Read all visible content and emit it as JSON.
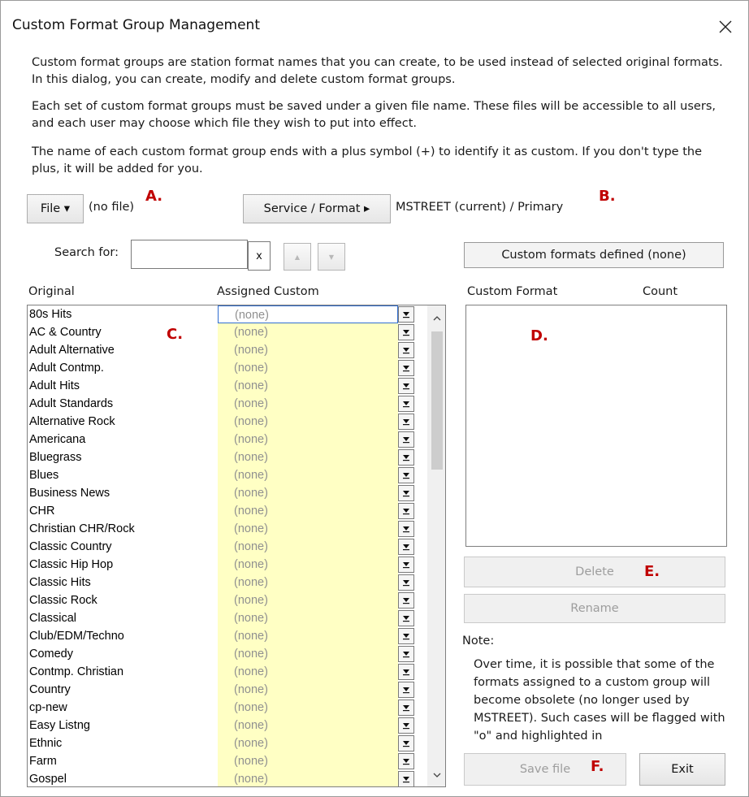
{
  "window": {
    "title": "Custom Format Group Management"
  },
  "intro": {
    "p1": "Custom format groups are station format names that you can create, to be used instead of selected original formats. In this dialog, you can create, modify and delete custom format groups.",
    "p2": "Each set of custom format groups must be saved under a given file name. These files will be accessible to all users, and each user may choose which file they wish to put into effect.",
    "p3": "The name of each custom format group ends with a plus symbol (+) to identify it as custom. If you don't type the plus, it will be added for you."
  },
  "toolbar": {
    "file_button": "File ▾",
    "file_status": "(no file)",
    "service_button": "Service / Format ▸",
    "service_status": "MSTREET (current) / Primary"
  },
  "search": {
    "label": "Search for:",
    "value": "",
    "clear_label": "x",
    "up_label": "▲",
    "down_label": "▼"
  },
  "status_box": "Custom formats defined (none)",
  "headers": {
    "original": "Original",
    "assigned": "Assigned Custom",
    "custom_format": "Custom Format",
    "count": "Count"
  },
  "rows": [
    {
      "original": "80s Hits",
      "assigned": "(none)"
    },
    {
      "original": "AC & Country",
      "assigned": "(none)"
    },
    {
      "original": "Adult Alternative",
      "assigned": "(none)"
    },
    {
      "original": "Adult Contmp.",
      "assigned": "(none)"
    },
    {
      "original": "Adult Hits",
      "assigned": "(none)"
    },
    {
      "original": "Adult Standards",
      "assigned": "(none)"
    },
    {
      "original": "Alternative Rock",
      "assigned": "(none)"
    },
    {
      "original": "Americana",
      "assigned": "(none)"
    },
    {
      "original": "Bluegrass",
      "assigned": "(none)"
    },
    {
      "original": "Blues",
      "assigned": "(none)"
    },
    {
      "original": "Business News",
      "assigned": "(none)"
    },
    {
      "original": "CHR",
      "assigned": "(none)"
    },
    {
      "original": "Christian CHR/Rock",
      "assigned": "(none)"
    },
    {
      "original": "Classic Country",
      "assigned": "(none)"
    },
    {
      "original": "Classic Hip Hop",
      "assigned": "(none)"
    },
    {
      "original": "Classic Hits",
      "assigned": "(none)"
    },
    {
      "original": "Classic Rock",
      "assigned": "(none)"
    },
    {
      "original": "Classical",
      "assigned": "(none)"
    },
    {
      "original": "Club/EDM/Techno",
      "assigned": "(none)"
    },
    {
      "original": "Comedy",
      "assigned": "(none)"
    },
    {
      "original": "Contmp. Christian",
      "assigned": "(none)"
    },
    {
      "original": "Country",
      "assigned": "(none)"
    },
    {
      "original": "cp-new",
      "assigned": "(none)"
    },
    {
      "original": "Easy Listng",
      "assigned": "(none)"
    },
    {
      "original": "Ethnic",
      "assigned": "(none)"
    },
    {
      "original": "Farm",
      "assigned": "(none)"
    },
    {
      "original": "Gospel",
      "assigned": "(none)"
    }
  ],
  "actions": {
    "delete": "Delete",
    "rename": "Rename",
    "save": "Save file",
    "exit": "Exit"
  },
  "note": {
    "label": "Note:",
    "text": "Over time, it is possible that some of the formats assigned to a custom group will become obsolete (no longer used by MSTREET). Such cases will be flagged with \"o\" and highlighted in"
  },
  "markers": {
    "a": "A.",
    "b": "B.",
    "c": "C.",
    "d": "D.",
    "e": "E.",
    "f": "F."
  },
  "colors": {
    "assigned_bg": "#ffffc4",
    "marker": "#c00000",
    "focus_border": "#2f6dd0"
  }
}
